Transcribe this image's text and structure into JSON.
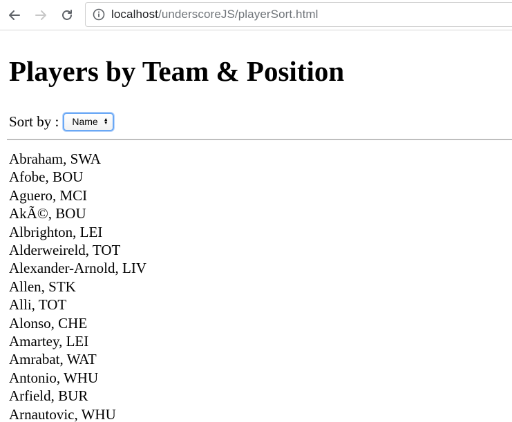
{
  "browser": {
    "url_host": "localhost",
    "url_path": "/underscoreJS/playerSort.html"
  },
  "page": {
    "title": "Players by Team & Position",
    "sort_label": "Sort by :",
    "sort_select_value": "Name"
  },
  "players": [
    "Abraham, SWA",
    "Afobe, BOU",
    "Aguero, MCI",
    "AkÃ©, BOU",
    "Albrighton, LEI",
    "Alderweireld, TOT",
    "Alexander-Arnold, LIV",
    "Allen, STK",
    "Alli, TOT",
    "Alonso, CHE",
    "Amartey, LEI",
    "Amrabat, WAT",
    "Antonio, WHU",
    "Arfield, BUR",
    "Arnautovic, WHU"
  ],
  "colors": {
    "select_focus": "#6aa8f5",
    "url_path": "#70757a"
  }
}
